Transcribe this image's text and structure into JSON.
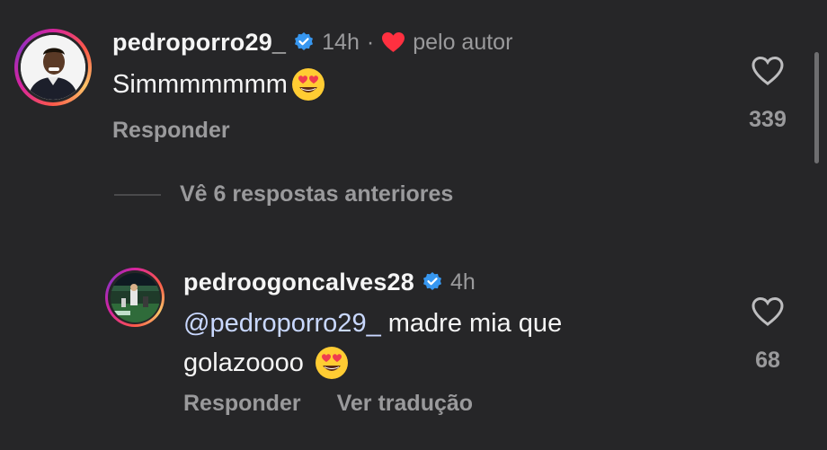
{
  "comments": [
    {
      "username": "pedroporro29_",
      "time": "14h",
      "separator": "·",
      "liked_by_author": "pelo autor",
      "text": "Simmmmmmm",
      "emoji": "heart-eyes-emoji",
      "reply_label": "Responder",
      "likes": "339",
      "avatar_icon": "profile-photo-player"
    },
    {
      "username": "pedroogoncalves28",
      "time": "4h",
      "mention": "@pedroporro29_",
      "text_line1": "madre mia que",
      "text_line2": "golazoooo",
      "emoji": "heart-eyes-emoji",
      "reply_label": "Responder",
      "translate_label": "Ver tradução",
      "likes": "68",
      "avatar_icon": "profile-photo-stadium"
    }
  ],
  "view_previous_replies": "Vê 6 respostas anteriores",
  "colors": {
    "background": "#262628",
    "verified": "#3797f0",
    "author_heart": "#ff3040",
    "muted": "#9a9a9c",
    "mention": "#c9d8ff"
  }
}
